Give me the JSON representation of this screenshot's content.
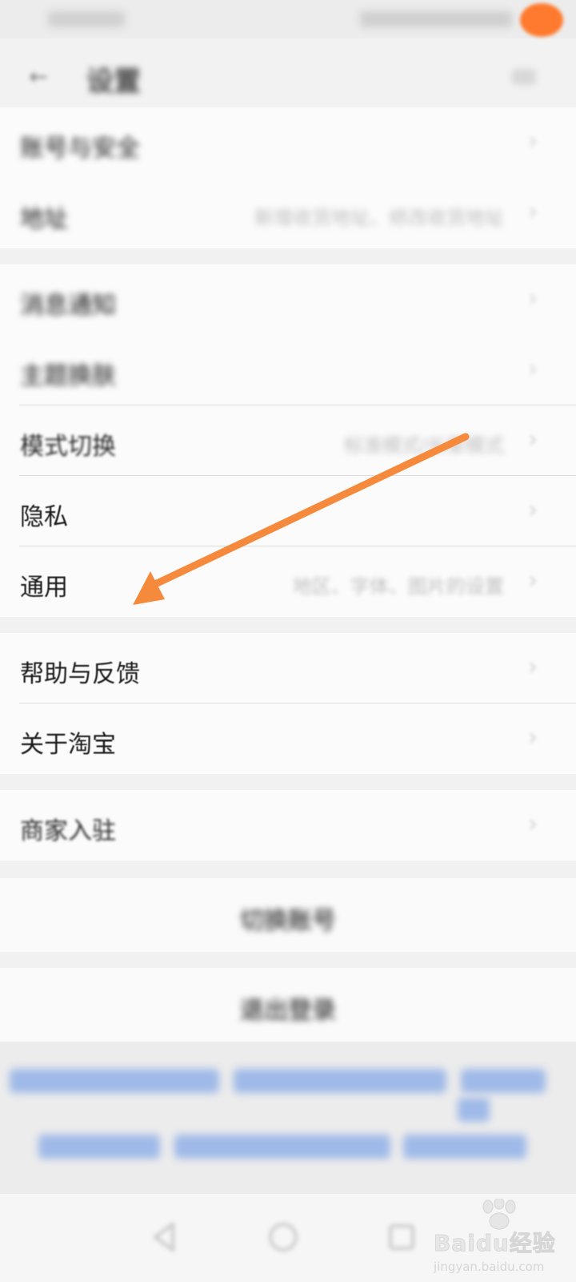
{
  "header": {
    "title": "设置"
  },
  "groups": [
    {
      "rows": [
        {
          "label": "账号与安全",
          "value": ""
        },
        {
          "label": "地址",
          "value": "新增收货地址、修改收货地址"
        }
      ]
    },
    {
      "rows": [
        {
          "label": "消息通知",
          "value": ""
        },
        {
          "label": "主题换肤",
          "value": ""
        },
        {
          "label": "模式切换",
          "value": "标准模式/长辈模式"
        },
        {
          "label": "隐私",
          "value": ""
        },
        {
          "label": "通用",
          "value": "地区、字体、图片的设置"
        }
      ]
    },
    {
      "rows": [
        {
          "label": "帮助与反馈",
          "value": ""
        },
        {
          "label": "关于淘宝",
          "value": ""
        }
      ]
    },
    {
      "rows": [
        {
          "label": "商家入驻",
          "value": ""
        }
      ]
    }
  ],
  "actions": {
    "switch_account": "切换账号",
    "logout": "退出登录"
  },
  "colors": {
    "annotation_arrow": "#f58a3c",
    "notification_dot": "#ff7a2e",
    "footer_link": "#9fb9e8"
  },
  "watermark": {
    "brand": "Baidu经验",
    "sub": "jingyan.baidu.com"
  }
}
